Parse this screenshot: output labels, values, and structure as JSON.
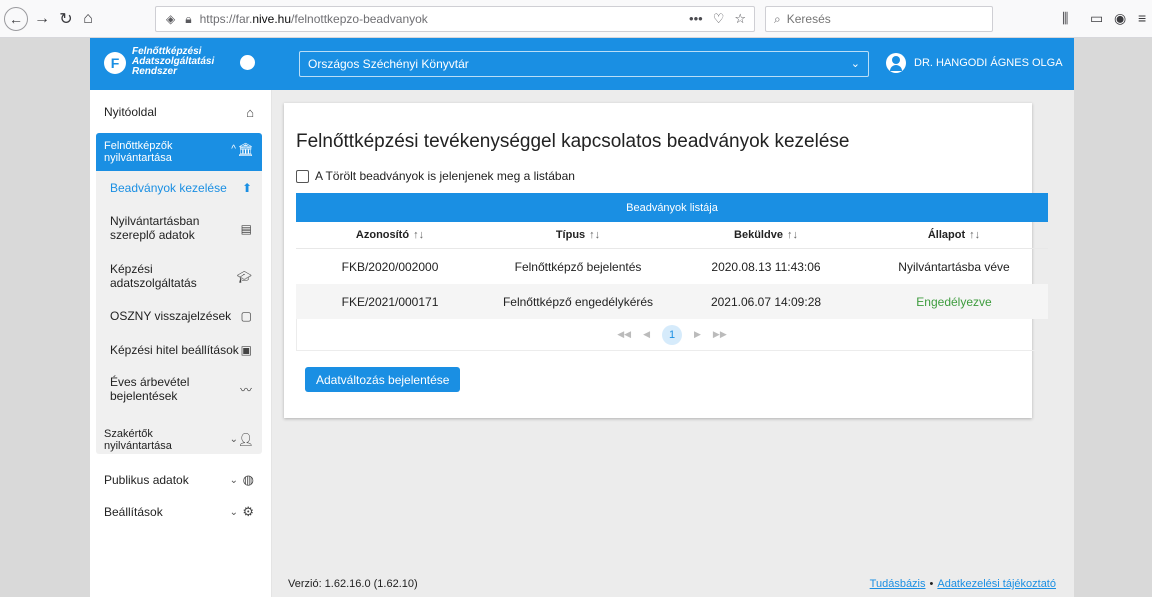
{
  "browser": {
    "url_prefix": "https://far.",
    "url_domain": "nive.hu",
    "url_path": "/felnottkepzo-beadvanyok",
    "more_glyph": "•••",
    "search_placeholder": "Keresés"
  },
  "app": {
    "logo_letter": "F",
    "logo_line1": "Felnőttképzési",
    "logo_line2": "Adatszolgáltatási",
    "logo_line3": "Rendszer",
    "org_selected": "Országos Széchényi Könyvtár",
    "user_name": "DR. HANGODI ÁGNES OLGA"
  },
  "sidebar": {
    "home": "Nyitóoldal",
    "active_group": "Felnőttképzők nyilvántartása",
    "subitems": [
      "Beadványok kezelése",
      "Nyilvántartásban szereplő adatok",
      "Képzési adatszolgáltatás",
      "OSZNY visszajelzések",
      "Képzési hitel beállítások",
      "Éves árbevétel bejelentések"
    ],
    "experts": "Szakértők nyilvántartása",
    "public": "Publikus adatok",
    "settings": "Beállítások"
  },
  "main": {
    "title": "Felnőttképzési tevékenységgel kapcsolatos beadványok kezelése",
    "checkbox_label": "A Törölt beadványok is jelenjenek meg a listában",
    "table_title": "Beadványok listája",
    "columns": [
      "Azonosító",
      "Típus",
      "Beküldve",
      "Állapot"
    ],
    "sort_glyph": "↑↓",
    "rows": [
      [
        "FKB/2020/002000",
        "Felnőttképző bejelentés",
        "2020.08.13 11:43:06",
        "Nyilvántartásba véve"
      ],
      [
        "FKE/2021/000171",
        "Felnőttképző engedélykérés",
        "2021.06.07 14:09:28",
        "Engedélyezve"
      ]
    ],
    "current_page": "1",
    "action_button": "Adatváltozás bejelentése"
  },
  "footer": {
    "version": "Verzió: 1.62.16.0 (1.62.10)",
    "link1": "Tudásbázis",
    "separator": "•",
    "link2": "Adatkezelési tájékoztató"
  },
  "colors": {
    "primary": "#1a8fe3",
    "status_approved": "#3e9c3e"
  }
}
